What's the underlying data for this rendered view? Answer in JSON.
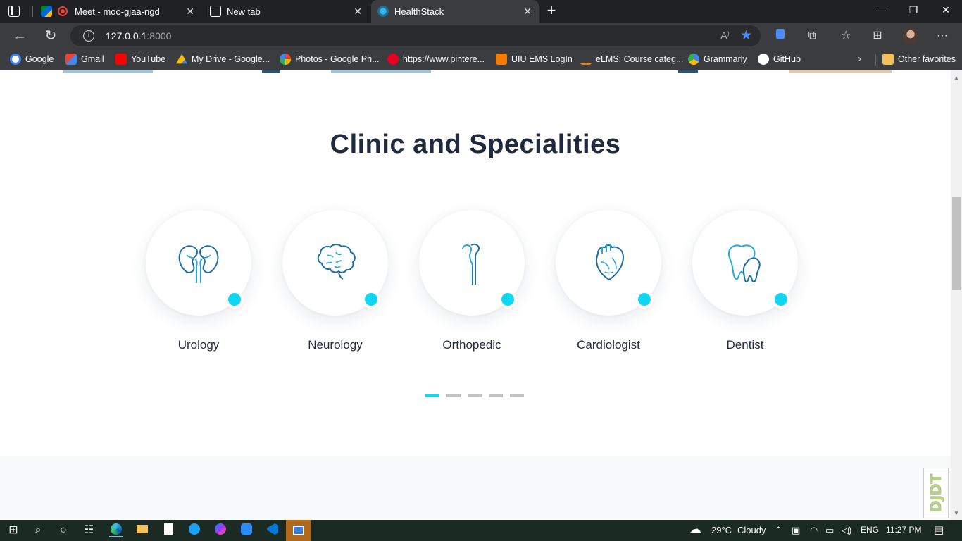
{
  "browser": {
    "tabs": [
      {
        "title": "Meet - moo-gjaa-ngd",
        "icon": "meet-icon"
      },
      {
        "title": "New tab",
        "icon": "newtab-icon"
      },
      {
        "title": "HealthStack",
        "icon": "healthstack-icon",
        "active": true
      }
    ],
    "url_host": "127.0.0.1",
    "url_port": ":8000",
    "read_aloud_label": "A⁾",
    "bookmarks": [
      {
        "label": "Google",
        "icon": "google-icon",
        "color": "#4285f4"
      },
      {
        "label": "Gmail",
        "icon": "gmail-icon",
        "color": "#ea4335"
      },
      {
        "label": "YouTube",
        "icon": "youtube-icon",
        "color": "#ff0000"
      },
      {
        "label": "My Drive - Google...",
        "icon": "drive-icon",
        "color": "#34a853"
      },
      {
        "label": "Photos - Google Ph...",
        "icon": "photos-icon",
        "color": "#fbbc04"
      },
      {
        "label": "https://www.pintere...",
        "icon": "pinterest-icon",
        "color": "#e60023"
      },
      {
        "label": "UIU EMS LogIn",
        "icon": "uiu-icon",
        "color": "#f57c00"
      },
      {
        "label": "eLMS: Course categ...",
        "icon": "elms-icon",
        "color": "#f57c00"
      },
      {
        "label": "Grammarly",
        "icon": "grammarly-icon",
        "color": "#15c39a"
      },
      {
        "label": "GitHub",
        "icon": "github-icon",
        "color": "#ffffff"
      }
    ],
    "other_favorites": "Other favorites"
  },
  "page": {
    "title": "Clinic and Specialities",
    "specialities": [
      {
        "label": "Urology",
        "icon": "kidney-icon"
      },
      {
        "label": "Neurology",
        "icon": "brain-icon"
      },
      {
        "label": "Orthopedic",
        "icon": "bone-icon"
      },
      {
        "label": "Cardiologist",
        "icon": "heart-icon"
      },
      {
        "label": "Dentist",
        "icon": "tooth-icon"
      }
    ],
    "carousel_pages": 5,
    "carousel_active": 1,
    "accent_color": "#0fd6f2",
    "debug_toolbar_label": "DJDT"
  },
  "taskbar": {
    "weather_temp": "29°C",
    "weather_text": "Cloudy",
    "language": "ENG",
    "time": "11:27 PM"
  }
}
